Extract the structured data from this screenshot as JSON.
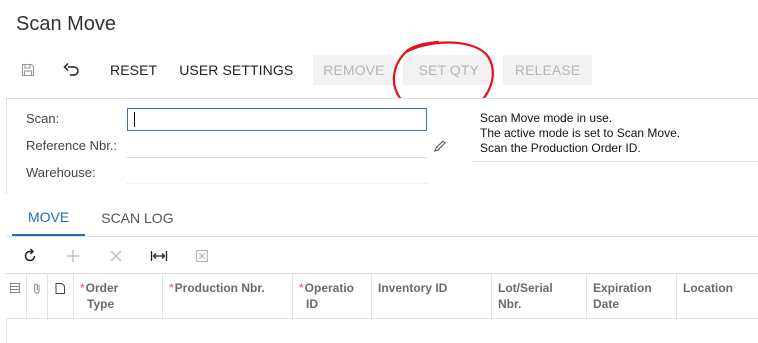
{
  "page": {
    "title": "Scan Move"
  },
  "toolbar": {
    "reset_label": "RESET",
    "user_settings_label": "USER SETTINGS",
    "remove_label": "REMOVE",
    "set_qty_label": "SET QTY",
    "release_label": "RELEASE",
    "icons": {
      "save": "save-icon",
      "undo": "undo-icon"
    }
  },
  "form": {
    "scan_label": "Scan:",
    "scan_value": "",
    "reference_label": "Reference Nbr.:",
    "warehouse_label": "Warehouse:"
  },
  "messages": [
    "Scan Move mode in use.",
    "The active mode is set to Scan Move.",
    "Scan the Production Order ID."
  ],
  "tabs": [
    {
      "label": "MOVE",
      "active": true
    },
    {
      "label": "SCAN LOG",
      "active": false
    }
  ],
  "grid": {
    "columns": [
      {
        "label": "Order Type",
        "required": true
      },
      {
        "label": "Production Nbr.",
        "required": true
      },
      {
        "label": "Operatio ID",
        "required": true
      },
      {
        "label": "Inventory ID",
        "required": false
      },
      {
        "label": "Lot/Serial Nbr.",
        "required": false
      },
      {
        "label": "Expiration Date",
        "required": false
      },
      {
        "label": "Location",
        "required": false
      }
    ],
    "col_lines": {
      "order_type": [
        "Order",
        "Type"
      ],
      "production_nbr": [
        "Production Nbr."
      ],
      "operation_id": [
        "Operatio",
        "ID"
      ],
      "inventory_id": [
        "Inventory ID"
      ],
      "lot_serial": [
        "Lot/Serial",
        "Nbr."
      ],
      "expiration": [
        "Expiration",
        "Date"
      ],
      "location": [
        "Location"
      ]
    },
    "required_mark": "*"
  },
  "colors": {
    "accent": "#1f6fb5",
    "input_border": "#3b74c6",
    "disabled_bg": "#f2f2f2",
    "disabled_text": "#b5b5b5",
    "required": "#d9534f",
    "annotation": "#e0141e"
  }
}
